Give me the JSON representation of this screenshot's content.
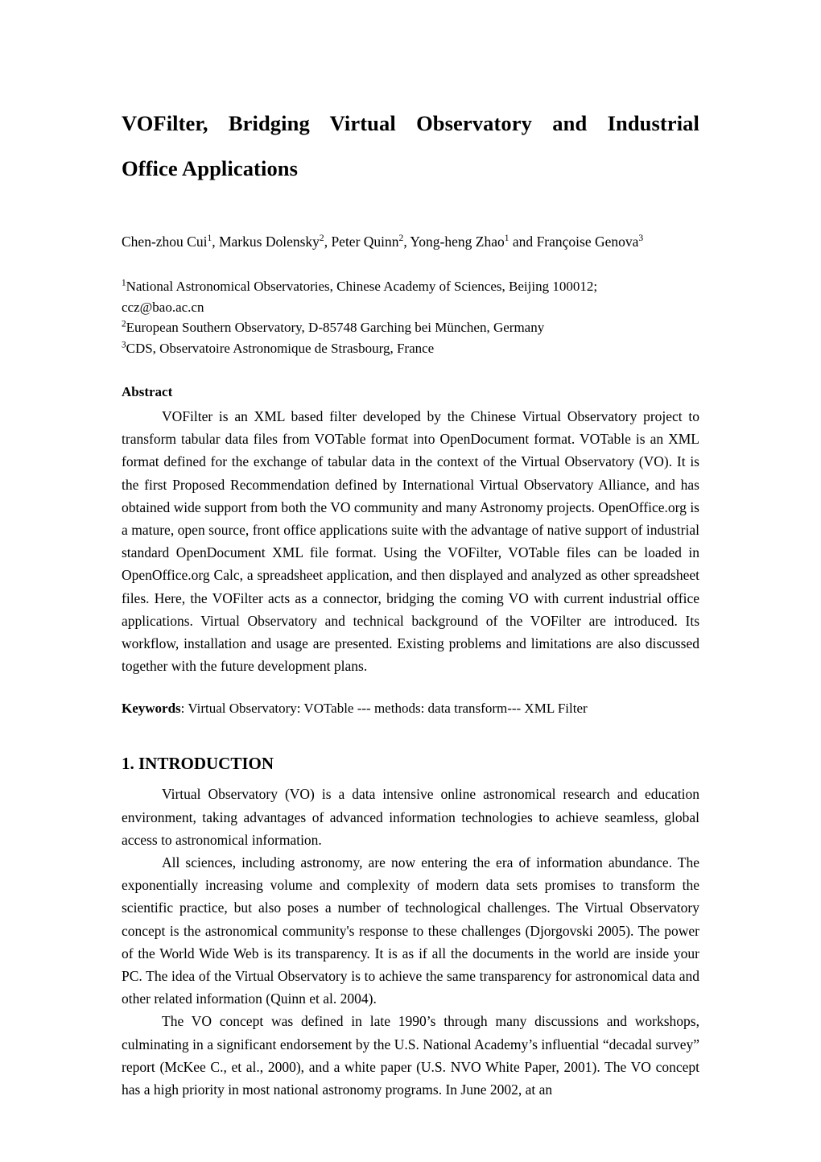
{
  "document": {
    "title_line1": "VOFilter, Bridging Virtual Observatory and Industrial",
    "title_line2": "Office Applications",
    "authors": {
      "a1_name": "Chen-zhou Cui",
      "a1_sup": "1",
      "sep1": ", ",
      "a2_name": "Markus Dolensky",
      "a2_sup": "2",
      "sep2": ", ",
      "a3_name": "Peter Quinn",
      "a3_sup": "2",
      "sep3": ", ",
      "a4_name": "Yong-heng Zhao",
      "a4_sup": "1",
      "sep4": " and ",
      "a5_name": "Françoise Genova",
      "a5_sup": "3"
    },
    "affiliations": [
      {
        "marker": "1",
        "text": "National Astronomical Observatories, Chinese Academy of Sciences, Beijing 100012;",
        "second_line": "ccz@bao.ac.cn"
      },
      {
        "marker": "2",
        "text": "European Southern Observatory, D-85748 Garching bei München, Germany",
        "second_line": ""
      },
      {
        "marker": "3",
        "text": "CDS, Observatoire Astronomique de Strasbourg, France",
        "second_line": ""
      }
    ],
    "abstract": {
      "heading": "Abstract",
      "body": "VOFilter is an XML based filter developed by the Chinese Virtual Observatory project to transform tabular data files from VOTable format into OpenDocument format. VOTable is an XML format defined for the exchange of tabular data in the context of the Virtual Observatory (VO). It is the first Proposed Recommendation defined by International Virtual Observatory Alliance, and has obtained wide support from both the VO community and many Astronomy projects. OpenOffice.org is a mature, open source, front office applications suite with the advantage of native support of industrial standard OpenDocument XML file format. Using the VOFilter, VOTable files can be loaded in OpenOffice.org Calc, a spreadsheet application, and then displayed and analyzed as other spreadsheet files. Here, the VOFilter acts as a connector, bridging the coming VO with current industrial office applications. Virtual Observatory and technical background of the VOFilter are introduced. Its workflow, installation and usage are presented. Existing problems and limitations are also discussed together with the future development plans."
    },
    "keywords": {
      "label": "Keywords",
      "text": ": Virtual Observatory: VOTable --- methods: data transform--- XML Filter"
    },
    "sections": [
      {
        "heading": "1. INTRODUCTION",
        "paragraphs": [
          "Virtual Observatory (VO) is a data intensive online astronomical research and education environment, taking advantages of advanced information technologies to achieve seamless, global access to astronomical information.",
          "All sciences, including astronomy, are now entering the era of information abundance. The exponentially increasing volume and complexity of modern data sets promises to transform the scientific practice, but also poses a number of technological challenges. The Virtual Observatory concept is the astronomical community's response to these challenges (Djorgovski 2005). The power of the World Wide Web is its transparency. It is as if all the documents in the world are inside your PC. The idea of the Virtual Observatory is to achieve the same transparency for astronomical data and other related information (Quinn et al. 2004).",
          "The VO concept was defined in late 1990’s through many discussions and workshops, culminating in a significant endorsement by the U.S. National Academy’s influential “decadal survey” report (McKee C., et al., 2000), and a white paper (U.S. NVO White Paper, 2001). The VO concept has a high priority in most national astronomy programs. In June 2002, at an"
        ]
      }
    ]
  }
}
